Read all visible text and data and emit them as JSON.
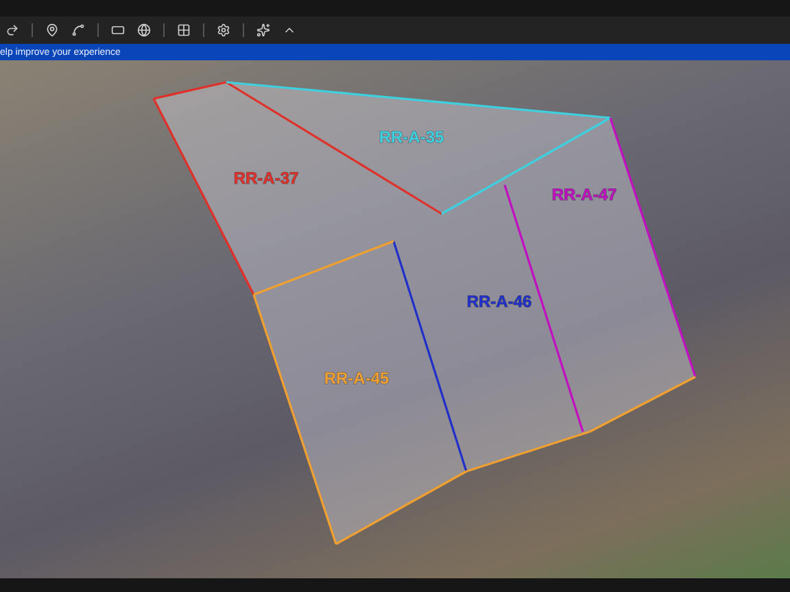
{
  "banner": {
    "text": "elp improve your experience"
  },
  "parcels": [
    {
      "label": "RR-A-35",
      "color": "#3fd0e0"
    },
    {
      "label": "RR-A-37",
      "color": "#e0302a"
    },
    {
      "label": "RR-A-47",
      "color": "#c010c0"
    },
    {
      "label": "RR-A-46",
      "color": "#2030c8"
    },
    {
      "label": "RR-A-45",
      "color": "#f0a030"
    }
  ]
}
